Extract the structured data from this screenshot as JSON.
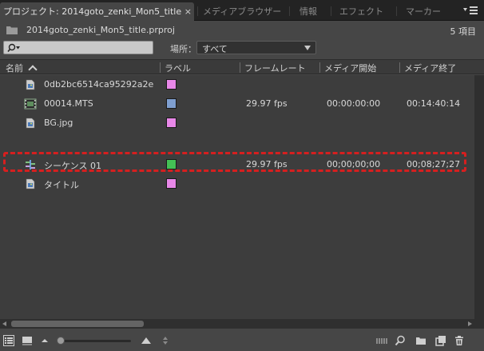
{
  "tabs": [
    {
      "label": "プロジェクト: 2014goto_zenki_Mon5_title",
      "active": true
    },
    {
      "label": "メディアブラウザー"
    },
    {
      "label": "情報"
    },
    {
      "label": "エフェクト"
    },
    {
      "label": "マーカー"
    }
  ],
  "project": {
    "file_name": "2014goto_zenki_Mon5_title.prproj",
    "item_count": "5 項目"
  },
  "search": {
    "value": "",
    "placeholder": ""
  },
  "location": {
    "label": "場所：",
    "value": "すべて"
  },
  "columns": {
    "name": "名前",
    "label": "ラベル",
    "frame_rate": "フレームレート",
    "media_start": "メディア開始",
    "media_end": "メディア終了"
  },
  "rows": [
    {
      "name": "0db2bc6514ca95292a2e",
      "label_color": "#e888e8",
      "frame_rate": "",
      "media_start": "",
      "media_end": "",
      "icon": "still-image-icon"
    },
    {
      "name": "00014.MTS",
      "label_color": "#7f9fd0",
      "frame_rate": "29.97 fps",
      "media_start": "00:00:00:00",
      "media_end": "00:14:40:14",
      "icon": "video-clip-icon"
    },
    {
      "name": "BG.jpg",
      "label_color": "#e888e8",
      "frame_rate": "",
      "media_start": "",
      "media_end": "",
      "icon": "still-image-icon"
    },
    {
      "name": "シーケンス 01",
      "label_color": "#44c055",
      "frame_rate": "29.97 fps",
      "media_start": "00;00;00;00",
      "media_end": "00;08;27;27",
      "icon": "sequence-icon"
    },
    {
      "name": "タイトル",
      "label_color": "#e888e8",
      "frame_rate": "",
      "media_start": "",
      "media_end": "",
      "icon": "title-icon"
    }
  ],
  "colors": {
    "panel_bg": "#464646",
    "list_bg": "#3d3d3d",
    "highlight": "#d61f1f"
  }
}
